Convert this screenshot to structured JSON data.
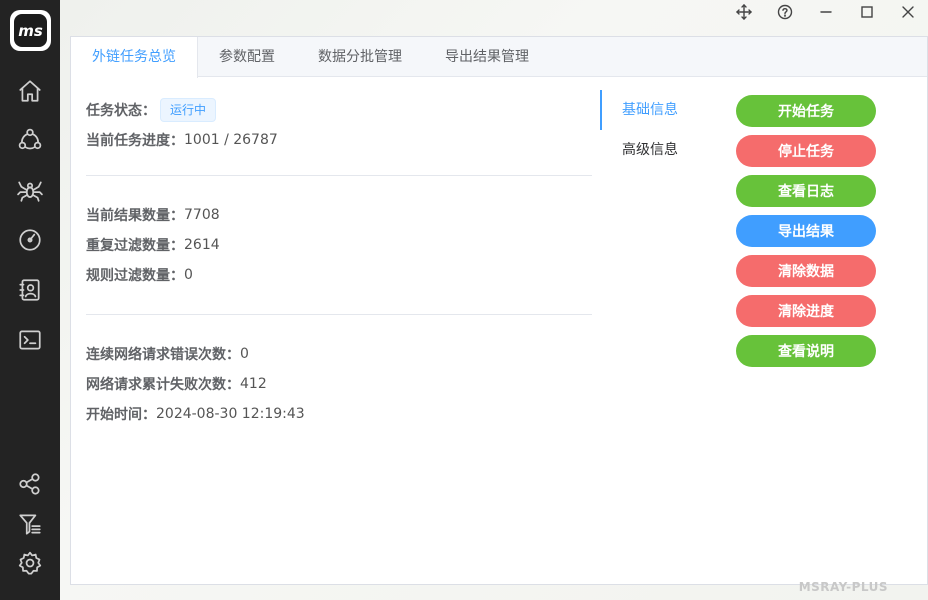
{
  "sidebar": {
    "logo_text": "ms",
    "top_icons": [
      "home-icon",
      "network-icon",
      "spider-icon",
      "gauge-icon",
      "contacts-icon",
      "terminal-icon"
    ],
    "bottom_icons": [
      "share-nodes-icon",
      "filter-icon",
      "gear-icon"
    ]
  },
  "window": {
    "controls": [
      "move-icon",
      "help-icon",
      "minimize-icon",
      "maximize-icon",
      "close-icon"
    ]
  },
  "tabs": [
    {
      "label": "外链任务总览",
      "active": true
    },
    {
      "label": "参数配置",
      "active": false
    },
    {
      "label": "数据分批管理",
      "active": false
    },
    {
      "label": "导出结果管理",
      "active": false
    }
  ],
  "overview": {
    "status_label": "任务状态：",
    "status_value": "运行中",
    "progress_label": "当前任务进度：",
    "progress_value": "1001 / 26787",
    "result_count_label": "当前结果数量：",
    "result_count_value": "7708",
    "dup_filter_label": "重复过滤数量：",
    "dup_filter_value": "2614",
    "rule_filter_label": "规则过滤数量：",
    "rule_filter_value": "0",
    "consecutive_err_label": "连续网络请求错误次数：",
    "consecutive_err_value": "0",
    "total_fail_label": "网络请求累计失败次数：",
    "total_fail_value": "412",
    "start_time_label": "开始时间：",
    "start_time_value": "2024-08-30 12:19:43"
  },
  "side_tabs": [
    {
      "label": "基础信息",
      "active": true
    },
    {
      "label": "高级信息",
      "active": false
    }
  ],
  "buttons": {
    "start": "开始任务",
    "stop": "停止任务",
    "view_log": "查看日志",
    "export": "导出结果",
    "clear_data": "清除数据",
    "clear_progress": "清除进度",
    "view_help": "查看说明"
  },
  "colors": {
    "primary": "#409eff",
    "success": "#67c23a",
    "danger": "#f56c6c",
    "sidebar": "#232323"
  },
  "watermark": "MSRAY-PLUS"
}
